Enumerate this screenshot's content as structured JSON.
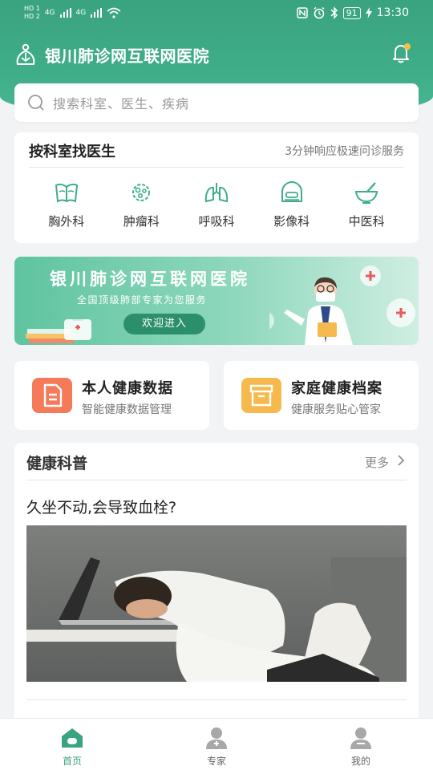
{
  "status_bar": {
    "sim1": "HD 1",
    "sim2": "HD 2",
    "net1": "4G",
    "net2": "4G",
    "battery": "91",
    "time": "13:30"
  },
  "app": {
    "title": "银川肺诊网互联网医院",
    "notification_badge": true
  },
  "search": {
    "placeholder": "搜索科室、医生、疾病"
  },
  "department_section": {
    "title": "按科室找医生",
    "subtitle": "3分钟响应极速问诊服务",
    "items": [
      {
        "label": "胸外科",
        "icon": "chest-icon"
      },
      {
        "label": "肿瘤科",
        "icon": "tumor-icon"
      },
      {
        "label": "呼吸科",
        "icon": "lungs-icon"
      },
      {
        "label": "影像科",
        "icon": "scanner-icon"
      },
      {
        "label": "中医科",
        "icon": "mortar-icon"
      }
    ]
  },
  "banner": {
    "title": "银川肺诊网互联网医院",
    "subtitle": "全国顶级肺部专家为您服务",
    "button": "欢迎进入"
  },
  "health_cards": [
    {
      "title": "本人健康数据",
      "subtitle": "智能健康数据管理",
      "icon": "document-icon",
      "color": "#f47a5a"
    },
    {
      "title": "家庭健康档案",
      "subtitle": "健康服务贴心管家",
      "icon": "archive-box-icon",
      "color": "#f6b94d"
    }
  ],
  "science_section": {
    "title": "健康科普",
    "more": "更多",
    "article_title": "久坐不动,会导致血栓?"
  },
  "tabbar": {
    "items": [
      {
        "label": "首页",
        "icon": "home-icon",
        "active": true
      },
      {
        "label": "专家",
        "icon": "doctor-icon",
        "active": false
      },
      {
        "label": "我的",
        "icon": "user-icon",
        "active": false
      }
    ]
  },
  "colors": {
    "brand_green": "#3fae88",
    "tab_active": "#3aa37f",
    "tab_inactive": "#999999"
  }
}
